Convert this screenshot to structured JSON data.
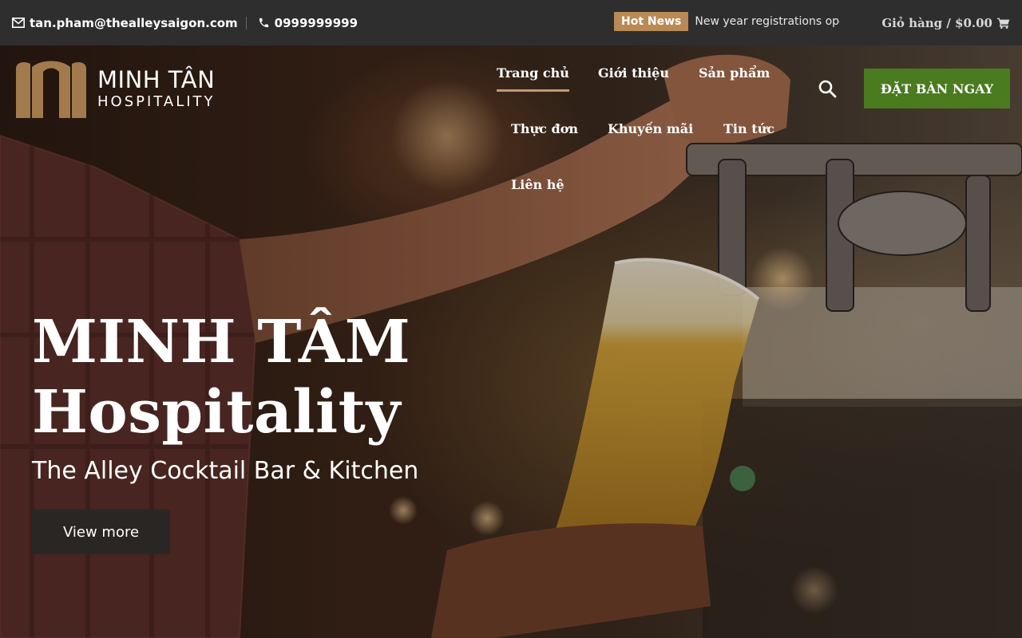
{
  "topbar": {
    "email": "tan.pham@thealleysaigon.com",
    "phone": "0999999999",
    "hot_label": "Hot News",
    "ticker_text": "New year registrations open",
    "cart": "Giỏ hàng / $0.00"
  },
  "logo": {
    "line1": "MINH TÂN",
    "line2": "HOSPITALITY",
    "mark_color": "#a27a4c"
  },
  "nav": {
    "items": [
      {
        "label": "Trang chủ",
        "active": true
      },
      {
        "label": "Giới thiệu"
      },
      {
        "label": "Sản phẩm"
      },
      {
        "label": "Thực đơn"
      },
      {
        "label": "Khuyến mãi"
      },
      {
        "label": "Tin tức"
      },
      {
        "label": "Liên hệ"
      }
    ],
    "book_label": "ĐẶT BÀN NGAY"
  },
  "hero": {
    "title_line1": "MINH TÂM",
    "title_line2": "Hospitality",
    "subtitle": "The Alley Cocktail Bar & Kitchen",
    "cta": "View more"
  },
  "colors": {
    "topbar_bg": "#2e2e2e",
    "accent_gold": "#c19a6b",
    "hot_badge": "#b98a55",
    "book_green": "#4a7b1f"
  }
}
